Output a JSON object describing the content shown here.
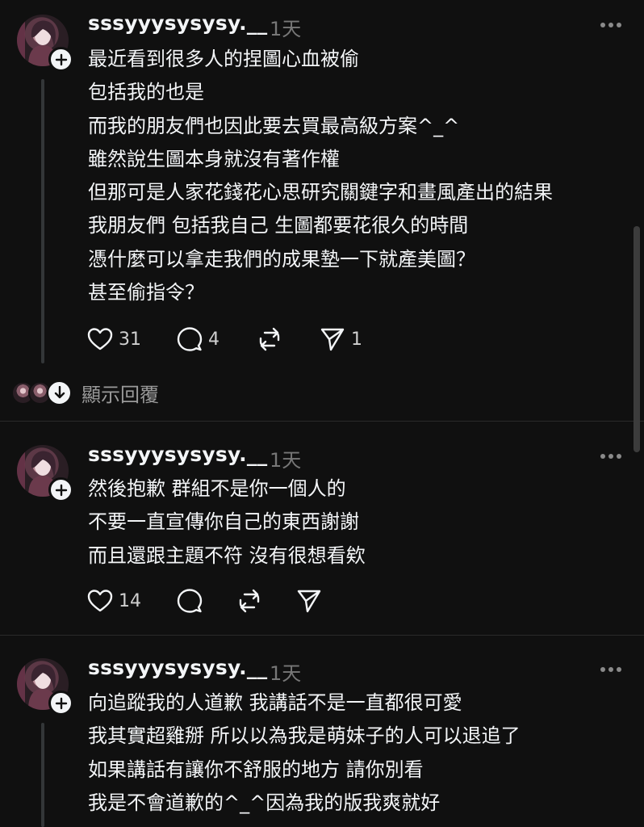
{
  "posts": [
    {
      "username": "sssyyysysysy.__",
      "time": "1天",
      "lines": [
        "最近看到很多人的捏圖心血被偷",
        "包括我的也是",
        "而我的朋友們也因此要去買最高級方案^_^",
        "雖然說生圖本身就沒有著作權",
        "但那可是人家花錢花心思研究關鍵字和畫風產出的結果",
        "我朋友們 包括我自己 生圖都要花很久的時間",
        "憑什麼可以拿走我們的成果墊一下就產美圖？",
        "甚至偷指令？"
      ],
      "likes": "31",
      "comments": "4",
      "reposts": "",
      "shares": "1",
      "show_replies": "顯示回覆"
    },
    {
      "username": "sssyyysysysy.__",
      "time": "1天",
      "lines": [
        "然後抱歉 群組不是你一個人的",
        "不要一直宣傳你自己的東西謝謝",
        "而且還跟主題不符 沒有很想看欸"
      ],
      "likes": "14",
      "comments": "",
      "reposts": "",
      "shares": ""
    },
    {
      "username": "sssyyysysysy.__",
      "time": "1天",
      "lines": [
        "向追蹤我的人道歉 我講話不是一直都很可愛",
        "我其實超雞掰 所以以為我是萌妹子的人可以退追了",
        "如果講話有讓你不舒服的地方 請你別看",
        "我是不會道歉的^_^因為我的版我爽就好"
      ]
    }
  ],
  "icons": {
    "like": "heart-icon",
    "comment": "comment-bubble-icon",
    "repost": "repost-icon",
    "share": "send-icon",
    "more": "more-horizontal-icon",
    "follow": "plus-icon",
    "expand": "arrow-down-icon"
  },
  "colors": {
    "background": "#101010",
    "text": "#f3f5f7",
    "muted": "#777777",
    "divider": "#2a2a2a"
  }
}
